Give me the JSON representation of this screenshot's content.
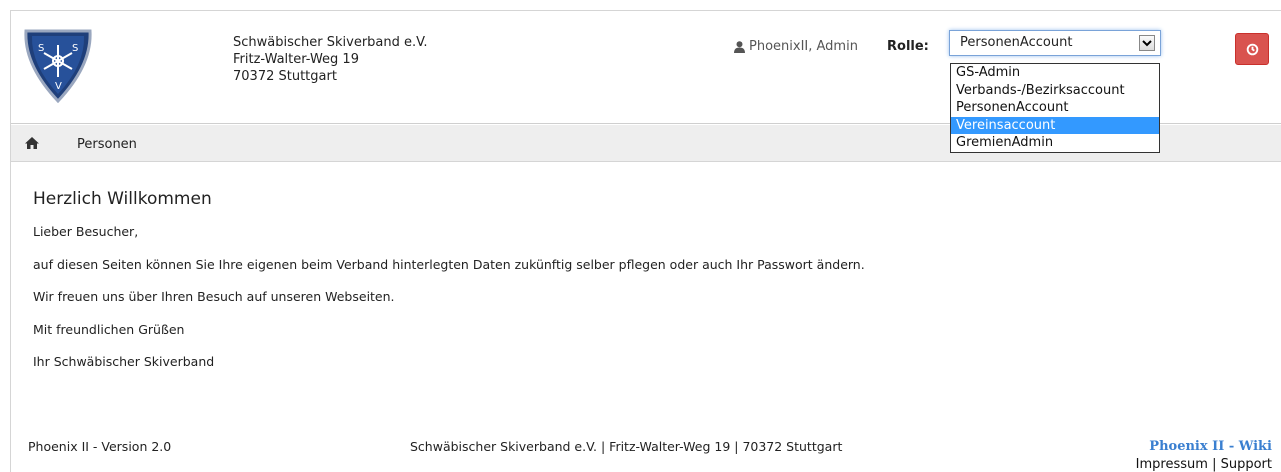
{
  "header": {
    "org_name": "Schwäbischer Skiverband e.V.",
    "street": "Fritz-Walter-Weg 19",
    "city": "70372 Stuttgart",
    "user": "PhoenixII, Admin",
    "role_label": "Rolle:",
    "role_selected": "PersonenAccount",
    "role_options": [
      "GS-Admin",
      "Verbands-/Bezirksaccount",
      "PersonenAccount",
      "Vereinsaccount",
      "GremienAdmin"
    ],
    "role_highlighted": "Vereinsaccount",
    "logo_text": [
      "S",
      "S",
      "V"
    ]
  },
  "nav": {
    "persons_label": "Personen"
  },
  "content": {
    "title": "Herzlich Willkommen",
    "paragraphs": [
      "Lieber Besucher,",
      "auf diesen Seiten können Sie Ihre eigenen beim Verband hinterlegten Daten zukünftig selber pflegen oder auch Ihr Passwort ändern.",
      "Wir freuen uns über Ihren Besuch auf unseren Webseiten.",
      "Mit freundlichen Grüßen",
      "Ihr Schwäbischer Skiverband"
    ]
  },
  "footer": {
    "version": "Phoenix II - Version 2.0",
    "address": "Schwäbischer Skiverband e.V. | Fritz-Walter-Weg 19 | 70372 Stuttgart",
    "wiki_link": "Phoenix II - Wiki",
    "impressum": "Impressum",
    "separator": "|",
    "support": "Support"
  },
  "colors": {
    "accent": "#3a7fd0",
    "logout": "#d9534f",
    "selection": "#3399ff",
    "nav_bg": "#eeeeee"
  },
  "icons": {
    "user": "user-icon",
    "home": "home-icon",
    "logout": "power-icon",
    "dropdown": "chevron-down-icon"
  }
}
